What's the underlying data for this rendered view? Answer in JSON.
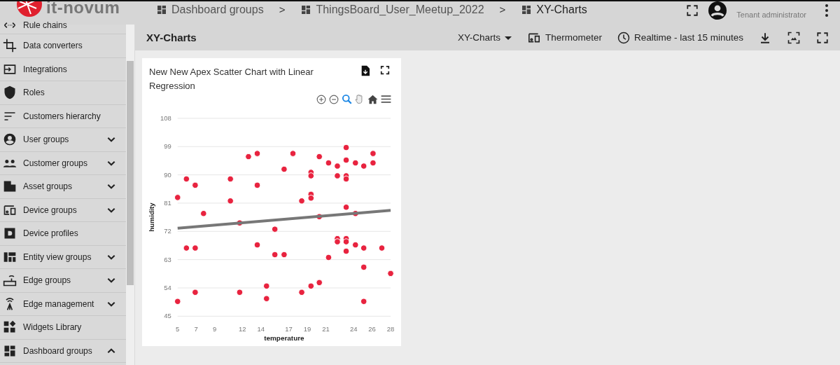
{
  "logo": {
    "text": "it-novum"
  },
  "breadcrumbs": [
    {
      "label": "Dashboard groups"
    },
    {
      "label": "ThingsBoard_User_Meetup_2022"
    },
    {
      "label": "XY-Charts"
    }
  ],
  "breadcrumb_separators": [
    ">",
    ">"
  ],
  "user": {
    "role": "Tenant administrator"
  },
  "sidebar": {
    "items": [
      {
        "label": "Rule chains"
      },
      {
        "label": "Data converters"
      },
      {
        "label": "Integrations"
      },
      {
        "label": "Roles"
      },
      {
        "label": "Customers hierarchy"
      },
      {
        "label": "User groups",
        "expanded": false
      },
      {
        "label": "Customer groups",
        "expanded": false
      },
      {
        "label": "Asset groups",
        "expanded": false
      },
      {
        "label": "Device groups",
        "expanded": false
      },
      {
        "label": "Device profiles"
      },
      {
        "label": "Entity view groups",
        "expanded": false
      },
      {
        "label": "Edge groups",
        "expanded": false
      },
      {
        "label": "Edge management",
        "expanded": false
      },
      {
        "label": "Widgets Library"
      },
      {
        "label": "Dashboard groups",
        "expanded": true
      }
    ]
  },
  "dashboard": {
    "title": "XY-Charts",
    "state_selector": "XY-Charts",
    "entity_alias": "Thermometer",
    "timewindow": "Realtime - last 15 minutes"
  },
  "widget": {
    "title": "New New Apex Scatter Chart with Linear Regression",
    "chart_data": {
      "type": "scatter",
      "xlabel": "temperature",
      "ylabel": "humidity",
      "xlim": [
        5,
        28
      ],
      "ylim": [
        45,
        108
      ],
      "xticks": [
        5,
        7,
        9,
        12,
        14,
        17,
        19,
        21,
        24,
        26,
        28
      ],
      "grid": true,
      "yticks": [
        45,
        54,
        63,
        72,
        81,
        90,
        99,
        108
      ],
      "series": [
        {
          "type": "scatter",
          "color": "#e8233f",
          "x": [
            5,
            5.95,
            6.9,
            7.8,
            5.95,
            6.9,
            5,
            6.9,
            10.7,
            10.7,
            11.7,
            11.7,
            12.65,
            13.6,
            13.6,
            13.6,
            14.6,
            14.6,
            15.5,
            15.5,
            16.5,
            16.5,
            17.45,
            18.4,
            18.4,
            19.4,
            19.4,
            19.4,
            19.4,
            19.4,
            20.3,
            20.3,
            20.3,
            21.3,
            21.3,
            22.25,
            22.25,
            22.25,
            22.25,
            23.2,
            23.2,
            23.2,
            23.2,
            23.2,
            23.2,
            23.2,
            23.2,
            24.2,
            24.2,
            24.2,
            25.1,
            25.1,
            25.1,
            25.1,
            26.1,
            26.1,
            27.05,
            28
          ],
          "values": [
            82.8,
            88.7,
            86.7,
            77.7,
            66.7,
            66.7,
            49.7,
            52.6,
            88.7,
            81.7,
            74.7,
            52.6,
            95.8,
            96.8,
            86.7,
            67.7,
            54.6,
            50.6,
            72.7,
            64.6,
            64.6,
            91.8,
            96.8,
            81.7,
            52.6,
            54.6,
            90.8,
            89.7,
            83.8,
            82.6,
            95.8,
            76.7,
            55.7,
            93.8,
            63.7,
            92.8,
            89.7,
            69.7,
            68.7,
            98.7,
            94.7,
            89.7,
            88.7,
            79.7,
            69.7,
            68.7,
            65.7,
            93.8,
            77.7,
            67.7,
            92.8,
            66.7,
            60.6,
            49.7,
            96.8,
            93.8,
            66.7,
            58.6
          ]
        },
        {
          "type": "line",
          "color": "#777777",
          "x": [
            5,
            28
          ],
          "values": [
            73,
            78.7
          ]
        }
      ]
    }
  }
}
